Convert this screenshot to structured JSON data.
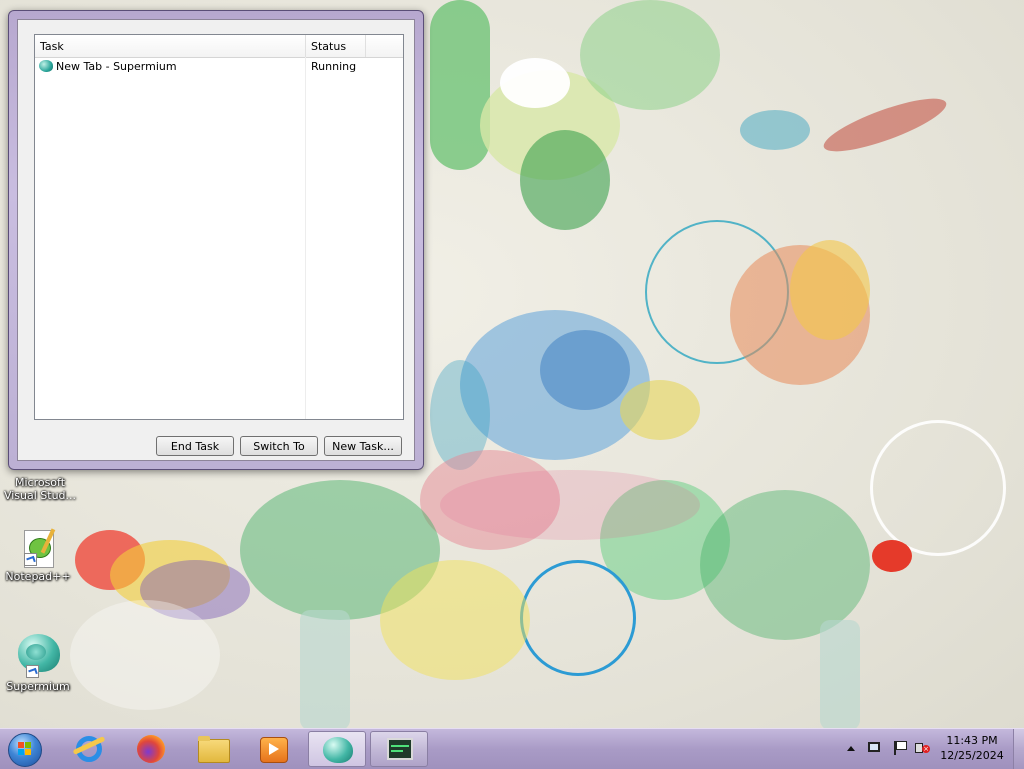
{
  "task_manager": {
    "columns": {
      "task": "Task",
      "status": "Status"
    },
    "tasks": [
      {
        "name": "New Tab - Supermium",
        "status": "Running",
        "icon": "supermium-icon"
      }
    ],
    "buttons": {
      "end_task": "End Task",
      "switch_to": "Switch To",
      "new_task": "New Task..."
    }
  },
  "desktop": {
    "icons": [
      {
        "label": "Microsoft Visual Stud...",
        "icon": "visual-studio-icon"
      },
      {
        "label": "Notepad++",
        "icon": "notepad-plus-plus-icon"
      },
      {
        "label": "Supermium",
        "icon": "supermium-icon"
      }
    ]
  },
  "taskbar": {
    "pinned": [
      "internet-explorer-icon",
      "firefox-icon",
      "file-explorer-icon",
      "media-player-icon",
      "supermium-icon",
      "task-manager-icon"
    ],
    "active_app": "supermium-icon",
    "clock": {
      "time": "11:43 PM",
      "date": "12/25/2024"
    }
  },
  "colors": {
    "taskbar": "#a99bc6",
    "window_frame": "#bcb0d4",
    "desktop_bg": "#e6e4da"
  }
}
